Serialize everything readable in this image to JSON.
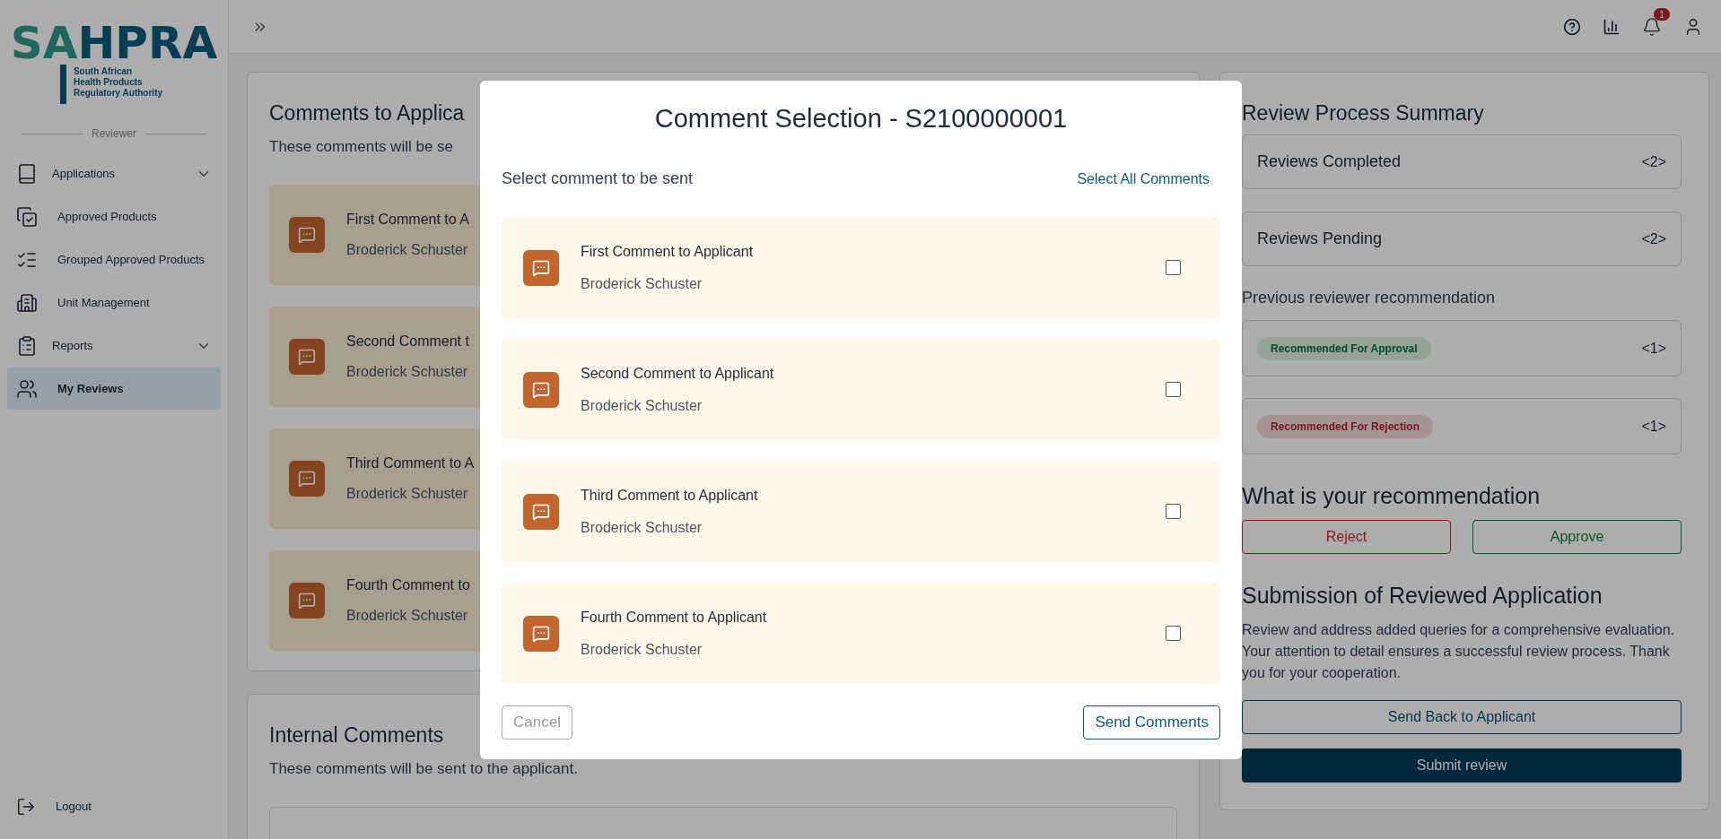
{
  "sidebar": {
    "logo": {
      "part_1": "SA",
      "part_2": "HPRA",
      "tagline": [
        "South African",
        "Health Products",
        "Regulatory Authority"
      ]
    },
    "section_label": "Reviewer",
    "items": [
      {
        "label": "Applications",
        "expandable": true,
        "selected": false
      },
      {
        "label": "Approved Products",
        "expandable": false,
        "selected": false
      },
      {
        "label": "Grouped Approved Products",
        "expandable": false,
        "selected": false
      },
      {
        "label": "Unit Management",
        "expandable": false,
        "selected": false
      },
      {
        "label": "Reports",
        "expandable": true,
        "selected": false
      },
      {
        "label": "My Reviews",
        "expandable": false,
        "selected": true
      }
    ],
    "logout": "Logout"
  },
  "header": {
    "notification_count": "1"
  },
  "comments_card": {
    "title": "Comments to Applica",
    "subtitle": "These comments will be se",
    "comments": [
      {
        "title": "First Comment to A",
        "author": "Broderick Schuster"
      },
      {
        "title": "Second Comment t",
        "author": "Broderick Schuster"
      },
      {
        "title": "Third Comment to A",
        "author": "Broderick Schuster"
      },
      {
        "title": "Fourth Comment to",
        "author": "Broderick Schuster"
      }
    ]
  },
  "internal_card": {
    "title": "Internal Comments",
    "subtitle": "These comments will be sent to the applicant."
  },
  "summary": {
    "title": "Review Process Summary",
    "stats": [
      {
        "label": "Reviews Completed",
        "count": "<2>"
      },
      {
        "label": "Reviews Pending",
        "count": "<2>"
      }
    ],
    "previous_label": "Previous reviewer recommendation",
    "previous": [
      {
        "badge": "Recommended For Approval",
        "kind": "approval",
        "count": "<1>"
      },
      {
        "badge": "Recommended For Rejection",
        "kind": "rejection",
        "count": "<1>"
      }
    ],
    "recommendation_title": "What is your recommendation",
    "recommendation_buttons": [
      {
        "label": "Reject",
        "kind": "reject"
      },
      {
        "label": "Approve",
        "kind": "approve"
      }
    ],
    "submission_title": "Submission of Reviewed Application",
    "submission_text": "Review and address added queries for a comprehensive evaluation. Your attention to detail ensures a successful review process. Thank you for your cooperation.",
    "send_back": "Send Back to Applicant",
    "submit": "Submit review"
  },
  "modal": {
    "title": "Comment Selection - S2100000001",
    "prompt": "Select comment to be sent",
    "select_all": "Select All Comments",
    "comments": [
      {
        "title": "First Comment to Applicant",
        "author": "Broderick Schuster",
        "checked": false
      },
      {
        "title": "Second Comment to Applicant",
        "author": "Broderick Schuster",
        "checked": false
      },
      {
        "title": "Third Comment to Applicant",
        "author": "Broderick Schuster",
        "checked": false
      },
      {
        "title": "Fourth Comment to Applicant",
        "author": "Broderick Schuster",
        "checked": false
      }
    ],
    "cancel": {
      "label": "Cancel",
      "disabled": true
    },
    "send": {
      "label": "Send Comments",
      "disabled": false
    }
  }
}
